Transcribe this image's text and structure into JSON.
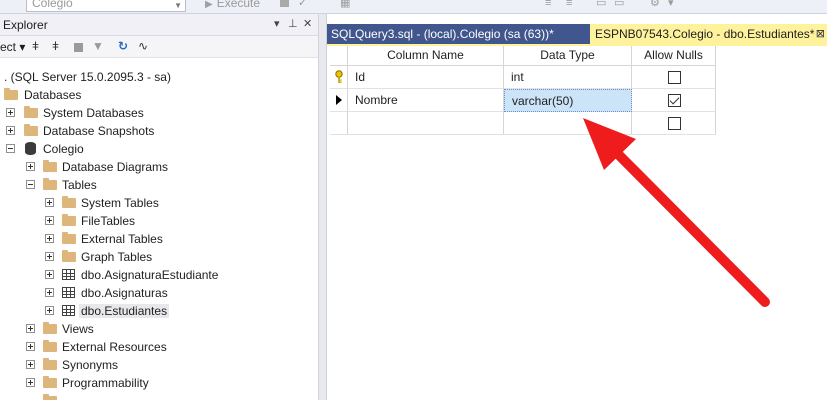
{
  "toolbar": {
    "database_combo": "Colegio",
    "execute_label": "Execute"
  },
  "explorer": {
    "title": "Explorer",
    "connect_label": "ect"
  },
  "tree": {
    "server": ". (SQL Server 15.0.2095.3 - sa)",
    "databases": "Databases",
    "system_databases": "System Databases",
    "database_snapshots": "Database Snapshots",
    "colegio": "Colegio",
    "database_diagrams": "Database Diagrams",
    "tables": "Tables",
    "system_tables": "System Tables",
    "filetables": "FileTables",
    "external_tables": "External Tables",
    "graph_tables": "Graph Tables",
    "asignatura_estudiante": "dbo.AsignaturaEstudiante",
    "asignaturas": "dbo.Asignaturas",
    "estudiantes": "dbo.Estudiantes",
    "views": "Views",
    "external_resources": "External Resources",
    "synonyms": "Synonyms",
    "programmability": "Programmability"
  },
  "tabs": {
    "query": "SQLQuery3.sql - (local).Colegio (sa (63))*",
    "design": "ESPNB07543.Colegio - dbo.Estudiantes*",
    "close_glyph": "⊠"
  },
  "grid": {
    "headers": {
      "column_name": "Column Name",
      "data_type": "Data Type",
      "allow_nulls": "Allow Nulls"
    },
    "rows": [
      {
        "column_name": "Id",
        "data_type": "int",
        "allow_nulls": false,
        "primary_key": true
      },
      {
        "column_name": "Nombre",
        "data_type": "varchar(50)",
        "allow_nulls": true,
        "current": true
      },
      {
        "column_name": "",
        "data_type": "",
        "allow_nulls": false
      }
    ]
  },
  "colors": {
    "tab_strip": "#40568d",
    "active_tab": "#fff29d",
    "annotation_arrow": "#ee1c1c",
    "selected_cell": "#cce4f7"
  }
}
